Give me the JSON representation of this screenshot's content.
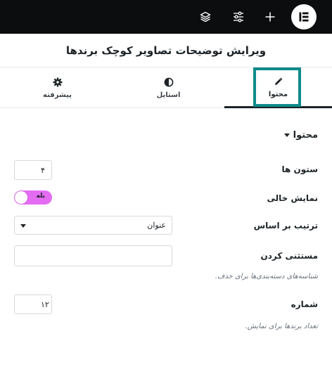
{
  "topbar": {
    "icons": [
      "layers-icon",
      "sliders-icon",
      "plus-icon",
      "elementor-logo-icon"
    ],
    "colors": {
      "background": "#0c0d0e",
      "icon": "#ffffff"
    }
  },
  "header": {
    "title": "ویرایش توضیحات تصاویر کوچک برندها"
  },
  "tabs": [
    {
      "label": "محتوا",
      "icon": "pencil-icon",
      "active": true
    },
    {
      "label": "استایل",
      "icon": "half-circle-icon",
      "active": false
    },
    {
      "label": "پیشرفته",
      "icon": "gear-icon",
      "active": false
    }
  ],
  "section": {
    "title": "محتوا",
    "expanded": true
  },
  "controls": {
    "columns": {
      "label": "ستون ها",
      "value": "۴"
    },
    "show_empty": {
      "label": "نمایش خالی",
      "toggle_text": "بله",
      "on": true
    },
    "order_by": {
      "label": "ترتیب بر اساس",
      "value": "عنوان"
    },
    "exclude": {
      "label": "مستثنی کردن",
      "value": "",
      "help": "شناسه‌های دسته‌بندی‌ها برای حذف."
    },
    "number": {
      "label": "شماره",
      "value": "۱۲",
      "help": "تعداد برندها برای نمایش."
    }
  },
  "colors": {
    "accent_toggle": "#e46cf2",
    "highlight_box": "#0f8a8a"
  }
}
